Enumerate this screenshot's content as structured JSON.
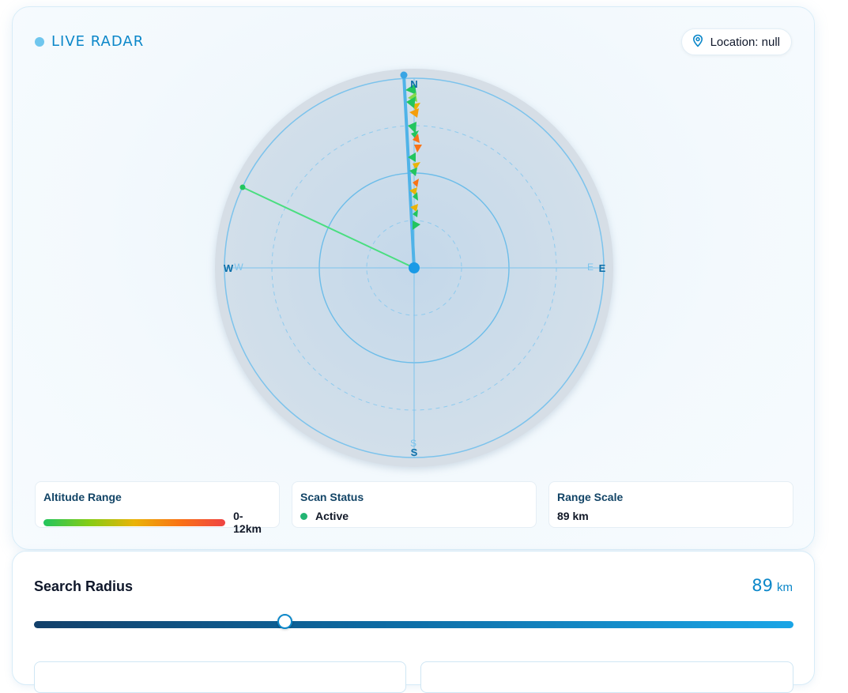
{
  "radar": {
    "title": "LIVE RADAR",
    "location_label": "Location: null",
    "compass": {
      "north": "N",
      "east": "E",
      "south": "S",
      "west": "W"
    },
    "colors": {
      "accent": "#0b87c9",
      "sweep": "#4ade80",
      "heading": "#4fb3e8"
    }
  },
  "stats": {
    "altitude": {
      "label": "Altitude Range",
      "value": "0-12km"
    },
    "scan": {
      "label": "Scan Status",
      "value": "Active"
    },
    "range": {
      "label": "Range Scale",
      "value": "89 km"
    }
  },
  "search": {
    "title": "Search Radius",
    "value": "89",
    "unit": "km",
    "slider_fraction": 0.33
  }
}
